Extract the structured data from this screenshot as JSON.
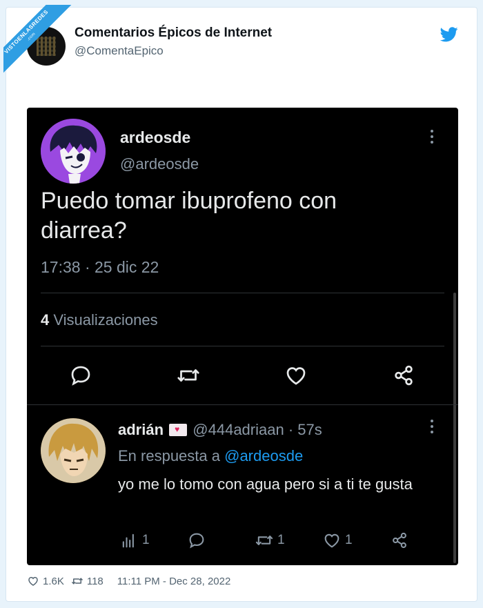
{
  "ribbon": {
    "text": "VISTOENLASREDES",
    "sub": ".com"
  },
  "header": {
    "account_name": "Comentarios Épicos de Internet",
    "handle": "@ComentaEpico"
  },
  "tweet": {
    "author_name": "ardeosde",
    "author_handle": "@ardeosde",
    "text": "Puedo tomar ibuprofeno con diarrea?",
    "timestamp": "17:38 · 25 dic 22",
    "views_count": "4",
    "views_label": "Visualizaciones"
  },
  "reply": {
    "author_name": "adrián",
    "author_handle": "@444adriaan",
    "age": "· 57s",
    "in_reply_prefix": "En respuesta a",
    "in_reply_handle": "@ardeosde",
    "text": "yo me lo tomo con agua pero si a ti te gusta",
    "views": "1",
    "retweets": "1",
    "likes": "1"
  },
  "footer": {
    "likes": "1.6K",
    "retweets": "118",
    "datetime": "11:11 PM - Dec 28, 2022"
  },
  "colors": {
    "accent": "#1d9bf0",
    "dark_bg": "#000000",
    "muted": "#8b98a5"
  }
}
